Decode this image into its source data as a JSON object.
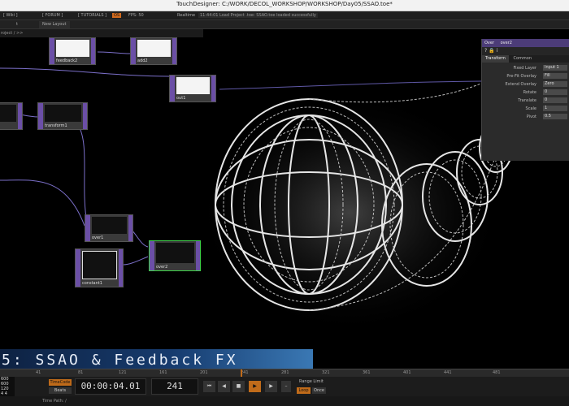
{
  "window": {
    "title": "TouchDesigner: C:/WORK/DECOL_WORKSHOP/WORKSHOP/Day05/SSAO.toe*"
  },
  "menubar": {
    "wiki": "[ Wiki ]",
    "forum": "[ FORUM ]",
    "tutorials": "[ TUTORIALS ]",
    "perf": "OS",
    "fps": "FPS: 50",
    "realtime": "Realtime",
    "log": "11:44:01 Load Project .toe: SSAO.toe loaded successfully"
  },
  "tabbar": {
    "tab1": "t",
    "new_layout": "New Layout"
  },
  "pathbar": {
    "path": "roject / >>"
  },
  "nodes": {
    "feedback2": "feedback2",
    "add2": "add2",
    "out1": "out1",
    "transform1": "transform1",
    "over1": "over1",
    "over2": "over2",
    "constant1": "constant1"
  },
  "panel": {
    "op_type": "Over",
    "op_name": "over2",
    "icons": "?  🔒  i",
    "tabs": [
      "Transform",
      "Common"
    ],
    "params": [
      {
        "label": "Fixed Layer",
        "value": "Input 1"
      },
      {
        "label": "Pre-Fit Overlay",
        "value": "Fill"
      },
      {
        "label": "Extend Overlay",
        "value": "Zero"
      },
      {
        "label": "Rotate",
        "value": "0"
      },
      {
        "label": "Translate",
        "value": "0"
      },
      {
        "label": "Scale",
        "value": "1"
      },
      {
        "label": "Pivot",
        "value": "0.5"
      }
    ]
  },
  "banner": {
    "text": "5: SSAO & Feedback FX"
  },
  "ruler": {
    "labels": [
      "41",
      "81",
      "121",
      "161",
      "201",
      "241",
      "281",
      "321",
      "361",
      "401",
      "441",
      "481"
    ]
  },
  "timebar": {
    "stats": [
      "600",
      "600",
      "120",
      "4  4"
    ],
    "timecode_label": "TimeCode",
    "beats_label": "Beats",
    "timecode": "00:00:04.01",
    "frame": "241",
    "buttons": [
      "⏮",
      "◀",
      "■",
      "▶",
      "▶",
      "–",
      "+"
    ],
    "range_limit": "Range Limit",
    "loop": "Loop",
    "once": "Once"
  },
  "timepath": {
    "label": "Time Path: /"
  }
}
